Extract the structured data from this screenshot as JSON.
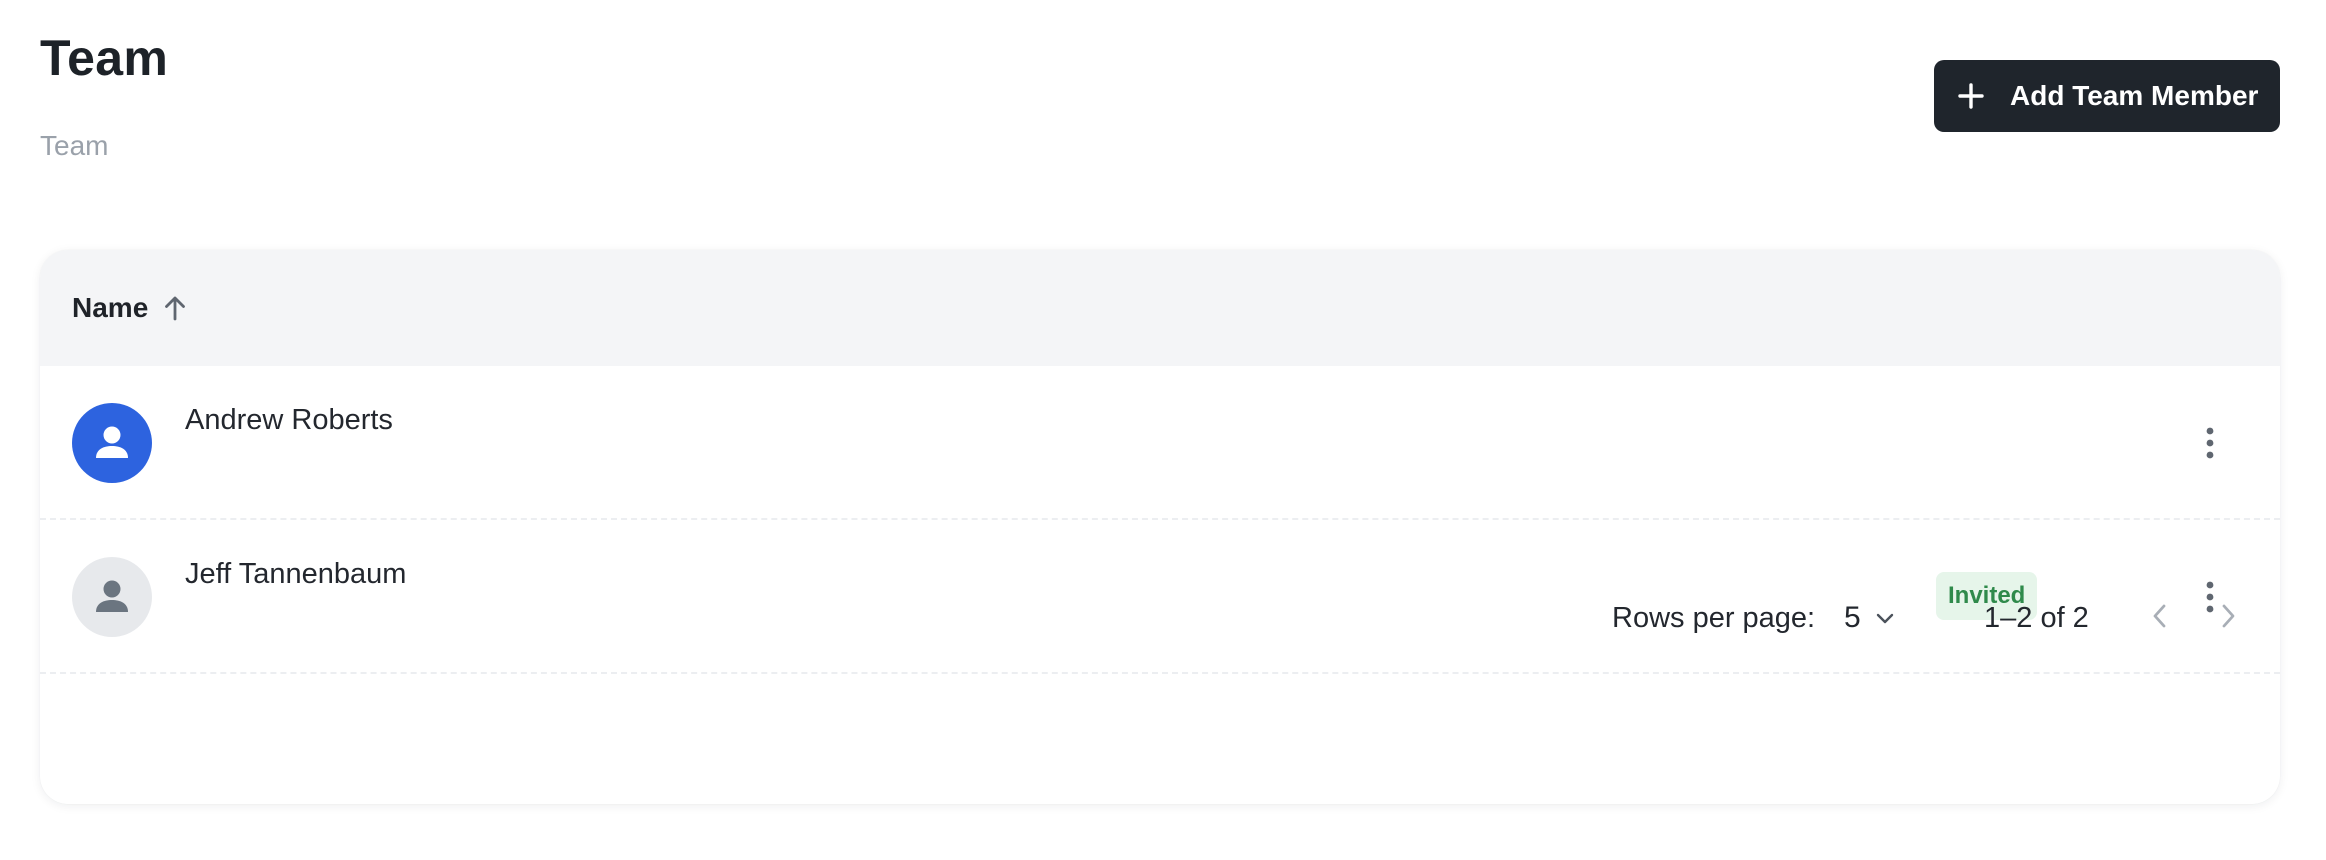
{
  "header": {
    "title": "Team",
    "breadcrumb": "Team",
    "add_button_label": "Add Team Member"
  },
  "table": {
    "columns": [
      {
        "label": "Name",
        "sort": "ascending"
      }
    ],
    "rows": [
      {
        "name": "Andrew Roberts",
        "status": "",
        "avatar_style": "primary"
      },
      {
        "name": "Jeff Tannenbaum",
        "status": "Invited",
        "avatar_style": "muted"
      }
    ]
  },
  "pagination": {
    "rows_per_page_label": "Rows per page:",
    "rows_per_page_value": "5",
    "range": "1–2 of 2"
  },
  "icons": {
    "add": "plus-icon",
    "sort": "arrow-up-icon",
    "avatar": "person-icon",
    "row_menu": "more-vertical-icon",
    "select": "chevron-down-icon",
    "prev": "chevron-left-icon",
    "next": "chevron-right-icon"
  },
  "colors": {
    "primary_button": "#1f252c",
    "avatar_primary": "#2d63df",
    "avatar_muted": "#e7e9ec",
    "badge_background": "#e6f5ea",
    "badge_text": "#2f8a4b",
    "table_header_background": "#f4f5f7"
  }
}
